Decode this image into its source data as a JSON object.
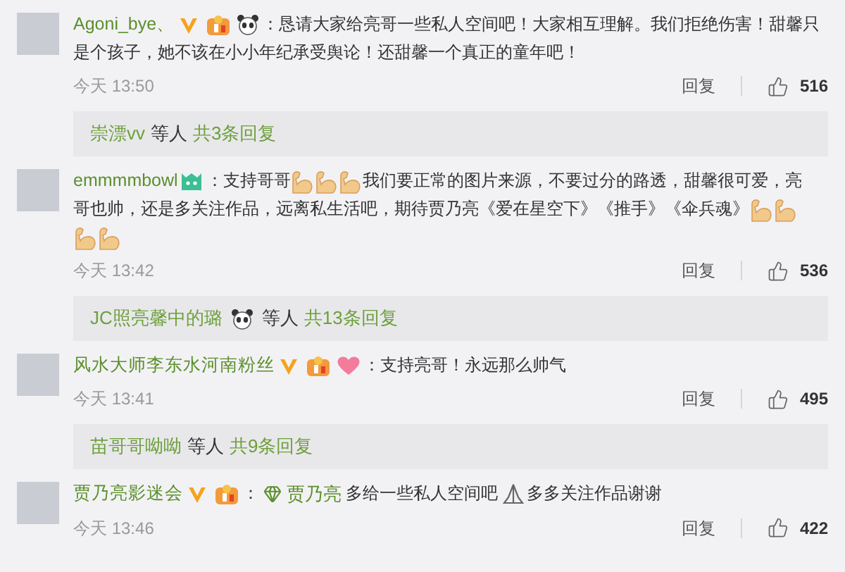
{
  "comments": [
    {
      "user": "Agoni_bye、",
      "badges": [
        {
          "kind": "verified"
        },
        {
          "kind": "level"
        },
        {
          "kind": "panda"
        }
      ],
      "content": [
        {
          "kind": "text",
          "text": "：恳请大家给亮哥一些私人空间吧！大家相互理解。我们拒绝伤害！甜馨只"
        },
        {
          "kind": "break"
        },
        {
          "kind": "text",
          "text": "是个孩子，她不该在小小年纪承受舆论！还甜馨一个真正的童年吧！"
        }
      ],
      "time": "今天 13:50",
      "reply_label": "回复",
      "likes": "516",
      "replies": {
        "user": "崇漂vv",
        "others": "等人",
        "total": "共3条回复"
      }
    },
    {
      "user": "emmmmbowl",
      "badges": [
        {
          "kind": "monster"
        }
      ],
      "content": [
        {
          "kind": "text",
          "text": "：支持哥哥"
        },
        {
          "kind": "arm"
        },
        {
          "kind": "arm"
        },
        {
          "kind": "arm"
        },
        {
          "kind": "text",
          "text": "我们要正常的图片来源，不要过分的路透，甜馨很可爱，亮"
        },
        {
          "kind": "break"
        },
        {
          "kind": "text",
          "text": "哥也帅，还是多关注作品，远离私生活吧，期待贾乃亮《爱在星空下》《推手》《伞兵魂》"
        },
        {
          "kind": "arm"
        },
        {
          "kind": "arm"
        },
        {
          "kind": "break"
        },
        {
          "kind": "arm"
        },
        {
          "kind": "arm"
        }
      ],
      "time": "今天 13:42",
      "reply_label": "回复",
      "likes": "536",
      "replies": {
        "user": "JC照亮馨中的璐",
        "badges": [
          {
            "kind": "panda"
          }
        ],
        "others": "等人",
        "total": "共13条回复"
      }
    },
    {
      "user": "风水大师李东水河南粉丝",
      "badges": [
        {
          "kind": "verified"
        },
        {
          "kind": "level"
        },
        {
          "kind": "heart"
        }
      ],
      "content": [
        {
          "kind": "text",
          "text": "：支持亮哥！永远那么帅气"
        }
      ],
      "time": "今天 13:41",
      "reply_label": "回复",
      "likes": "495",
      "replies": {
        "user": "苗哥哥呦呦",
        "others": "等人",
        "total": "共9条回复"
      }
    },
    {
      "user": "贾乃亮影迷会",
      "badges": [
        {
          "kind": "verified"
        },
        {
          "kind": "level"
        }
      ],
      "content": [
        {
          "kind": "text",
          "text": "：  "
        },
        {
          "kind": "mention",
          "text": "贾乃亮"
        },
        {
          "kind": "text",
          "text": " 多给一些私人空间吧 "
        },
        {
          "kind": "pray"
        },
        {
          "kind": "text",
          "text": "多多关注作品谢谢"
        }
      ],
      "time": "今天 13:46",
      "reply_label": "回复",
      "likes": "422"
    }
  ]
}
